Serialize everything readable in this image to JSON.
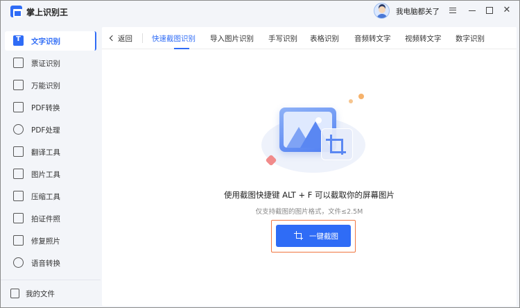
{
  "app": {
    "title": "掌上识别王",
    "username": "我电脑都关了"
  },
  "window_controls": {
    "menu": "menu-icon",
    "minimize": "minimize-icon",
    "maximize": "maximize-icon",
    "close": "close-icon"
  },
  "sidebar": {
    "items": [
      {
        "label": "文字识别",
        "icon": "text-recognition-icon",
        "active": true
      },
      {
        "label": "票证识别",
        "icon": "ticket-icon"
      },
      {
        "label": "万能识别",
        "icon": "universal-scan-icon"
      },
      {
        "label": "PDF转换",
        "icon": "pdf-convert-icon"
      },
      {
        "label": "PDF处理",
        "icon": "pdf-process-icon"
      },
      {
        "label": "翻译工具",
        "icon": "translate-icon"
      },
      {
        "label": "图片工具",
        "icon": "image-tool-icon"
      },
      {
        "label": "压缩工具",
        "icon": "compress-icon"
      },
      {
        "label": "拍证件照",
        "icon": "id-photo-icon"
      },
      {
        "label": "修复照片",
        "icon": "photo-repair-icon"
      },
      {
        "label": "语音转换",
        "icon": "voice-convert-icon"
      }
    ],
    "footer": {
      "label": "我的文件",
      "icon": "my-files-icon"
    }
  },
  "tabs": {
    "back_label": "返回",
    "items": [
      {
        "label": "快速截图识别",
        "active": true
      },
      {
        "label": "导入图片识别"
      },
      {
        "label": "手写识别"
      },
      {
        "label": "表格识别"
      },
      {
        "label": "音频转文字"
      },
      {
        "label": "视频转文字"
      },
      {
        "label": "数字识别"
      }
    ]
  },
  "main": {
    "headline": "使用截图快捷键 ALT + F 可以截取你的屏幕图片",
    "subline": "仅支持截图的图片格式，文件≤2.5M",
    "cta_label": "一键截图",
    "cta_icon": "crop-icon"
  },
  "colors": {
    "accent": "#2f6cf6",
    "highlight_border": "#f0753f",
    "background": "#f3f5f9"
  }
}
